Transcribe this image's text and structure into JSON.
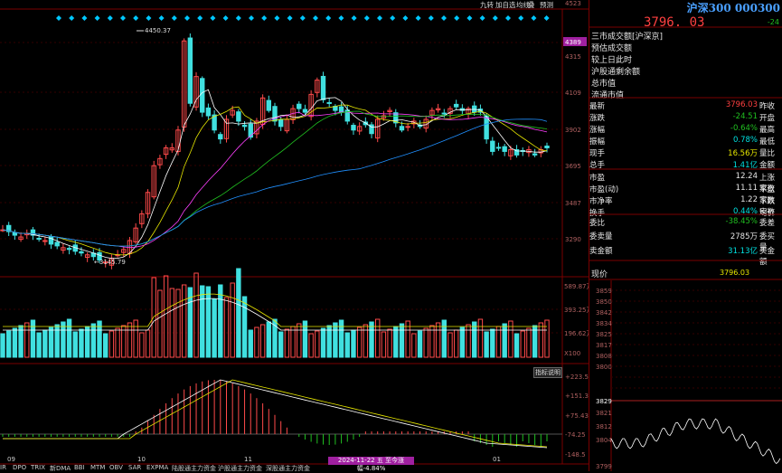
{
  "toolbar": {
    "top_icons": [
      "九转",
      "加自选",
      "均线",
      "叠",
      "预测"
    ],
    "price_top": "4523"
  },
  "chart": {
    "high_label": "4450.37",
    "low_label": "3145.79",
    "y_ticks": [
      "4523",
      "4389",
      "4315",
      "4109",
      "3902",
      "3695",
      "3487",
      "3290"
    ],
    "current_tag": "4389",
    "x_labels": [
      "09",
      "10",
      "11",
      "12",
      "01"
    ],
    "volume_ticks": [
      "589.87万",
      "393.25万",
      "196.62万",
      "X100"
    ],
    "macd_ticks": [
      "+223.5",
      "+151.3",
      "+75.43",
      "-74.25",
      "-148.5"
    ],
    "help_label": "指标说明",
    "date_bar": "2024-11-22 五 至今涨幅-4.84%",
    "bottom_tabs": [
      "IR",
      "DPO",
      "TRIX",
      "新DMA",
      "BBI",
      "MTM",
      "OBV",
      "SAR",
      "EXPMA",
      "陆股通主力资金",
      "沪股通主力资金",
      "深股通主力资金"
    ]
  },
  "quote": {
    "name": "沪深300 000300",
    "price": "3796. 03",
    "change": "-24",
    "info_lines": [
      "三市成交额[沪深京]",
      "预估成交额",
      "较上日此时",
      "沪股通剩余额",
      "总市值",
      "流通市值"
    ],
    "rows": [
      {
        "l": "最新",
        "v": "3796.03",
        "vc": "red",
        "r": "昨收"
      },
      {
        "l": "涨跌",
        "v": "-24.51",
        "vc": "green",
        "r": "开盘"
      },
      {
        "l": "涨幅",
        "v": "-0.64%",
        "vc": "green",
        "r": "最高"
      },
      {
        "l": "振幅",
        "v": "0.78%",
        "vc": "cyan",
        "r": "最低"
      },
      {
        "l": "现手",
        "v": "16.56万",
        "vc": "yellow",
        "r": "量比"
      },
      {
        "l": "总手",
        "v": "1.41亿",
        "vc": "cyan",
        "r": "金额"
      },
      {
        "l": "市盈",
        "v": "12.24",
        "vc": "white",
        "r": "上涨家数"
      },
      {
        "l": "市盈(动)",
        "v": "11.11",
        "vc": "white",
        "r": "平盘家数"
      },
      {
        "l": "市净率",
        "v": "1.22",
        "vc": "white",
        "r": "下跌家数"
      },
      {
        "l": "换手",
        "v": "0.44%",
        "vc": "cyan",
        "r": "均价"
      },
      {
        "l": "委比",
        "v": "-38.45%",
        "vc": "green",
        "r": "委差"
      },
      {
        "l": "委卖量",
        "v": "2785万",
        "vc": "white",
        "r": "委买量"
      },
      {
        "l": "卖金额",
        "v": "31.13亿",
        "vc": "cyan",
        "r": "买金额"
      }
    ],
    "now_label": "现价",
    "now_value": "3796.03",
    "intraday_ticks": [
      "3859",
      "3850",
      "3842",
      "3834",
      "3825",
      "3817",
      "3808",
      "3800",
      "3829",
      "3821",
      "3812",
      "3804",
      "3799"
    ]
  }
}
